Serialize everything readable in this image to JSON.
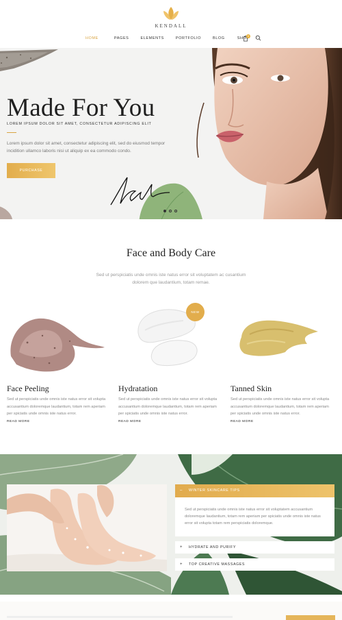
{
  "brand": {
    "name": "KENDALL",
    "accent": "#d9a441"
  },
  "nav": {
    "items": [
      {
        "label": "HOME",
        "active": true
      },
      {
        "label": "PAGES",
        "active": false
      },
      {
        "label": "ELEMENTS",
        "active": false
      },
      {
        "label": "PORTFOLIO",
        "active": false
      },
      {
        "label": "BLOG",
        "active": false
      },
      {
        "label": "SHOP",
        "active": false
      }
    ],
    "cart_icon": "shopping-bag-icon",
    "cart_count": "0",
    "search_icon": "search-icon"
  },
  "hero": {
    "title": "Made For You",
    "subtitle": "LOREM IPSUM DOLOR SIT AMET, CONSECTETUR ADIPISCING ELIT",
    "text": "Lorem ipsum dolor sit amet, consectetur adipiscing elit, sed do eiusmod tempor incidition ullamco laboris nisi ut aliquip ex ea commodo condo.",
    "button": "PURCHASE"
  },
  "care": {
    "title": "Face and Body Care",
    "subtitle": "Sed ut perspiciatis unde omnis iste natus error sit voluptatem ac cusantium dolorem que laudantium, totam remae.",
    "badge": "NEW",
    "items": [
      {
        "title": "Face Peeling",
        "text": "Sed ut perspiciatis unde omnis iste natus error sit volupta accusantium doloremque laudantium, totam rem aperiam per spiciatis unde omnis iste natus error.",
        "more": "READ MORE"
      },
      {
        "title": "Hydratation",
        "text": "Sed ut perspiciatis unde omnis iste natus error sit volupta accusantium doloremque laudantium, totam rem aperiam per spiciatis unde omnis iste natus error.",
        "more": "READ MORE"
      },
      {
        "title": "Tanned Skin",
        "text": "Sed ut perspiciatis unde omnis iste natus error sit volupta accusantium doloremque laudantium, totam rem aperiam per spiciatis unde omnis iste natus error.",
        "more": "READ MORE"
      }
    ]
  },
  "tips": {
    "active_title": "WINTER SKINCARE TIPS",
    "active_text": "Sed ut perspiciatis unde omnis iste natus error sit voluptatem accusantium doloremque laudantium, totam rem aperiam per spiciatis unde omnis iste natus error sit volupta totam rem perspiciatis doloremque.",
    "items": [
      "HYDRATE AND PURIFY",
      "TOP CREATIVE MASSAGES"
    ],
    "collapse_icon": "minus-icon",
    "expand_icon": "plus-icon"
  }
}
